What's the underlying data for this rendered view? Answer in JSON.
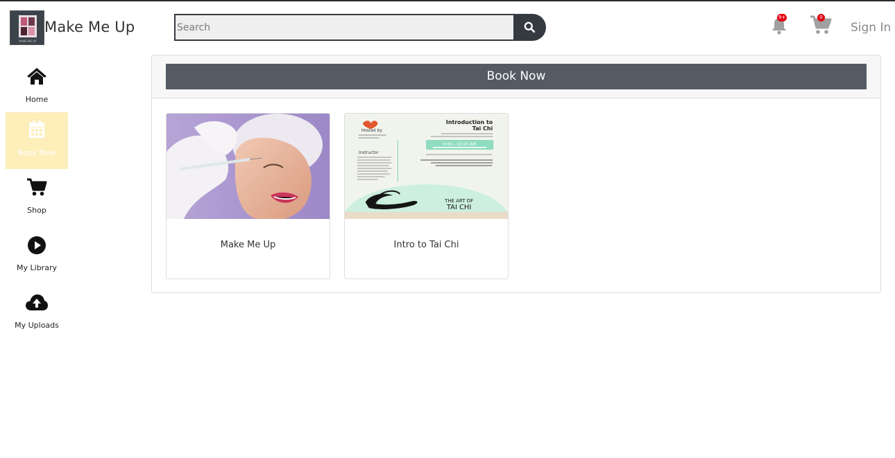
{
  "header": {
    "app_title": "Make Me Up",
    "logo_text": "MAKE ME UP",
    "search_placeholder": "Search",
    "notifications_badge": "9+",
    "cart_badge": "0",
    "sign_in_label": "Sign In"
  },
  "sidebar": {
    "items": [
      {
        "label": "Home",
        "icon": "home-icon"
      },
      {
        "label": "Book Now",
        "icon": "calendar-icon",
        "active": true
      },
      {
        "label": "Shop",
        "icon": "cart-icon"
      },
      {
        "label": "My Library",
        "icon": "play-circle-icon"
      },
      {
        "label": "My Uploads",
        "icon": "cloud-upload-icon"
      }
    ]
  },
  "main": {
    "banner_label": "Book Now",
    "events": [
      {
        "title": "Make Me Up"
      },
      {
        "title": "Intro to Tai Chi",
        "poster": {
          "heading_line1": "Introduction to",
          "heading_line2": "Tai Chi",
          "hosted_by": "Hosted by",
          "instructor": "Instructor",
          "time": "9:00 - 10:00 AM",
          "brand_line1": "THE ART OF",
          "brand_line2": "TAI CHI"
        }
      }
    ]
  },
  "colors": {
    "banner_bg": "#545b64",
    "search_button_bg": "#343a40",
    "active_sidebar_bg": "#fdeeba",
    "badge_red": "#e3000f",
    "poster_teal": "#a7e3cf"
  }
}
